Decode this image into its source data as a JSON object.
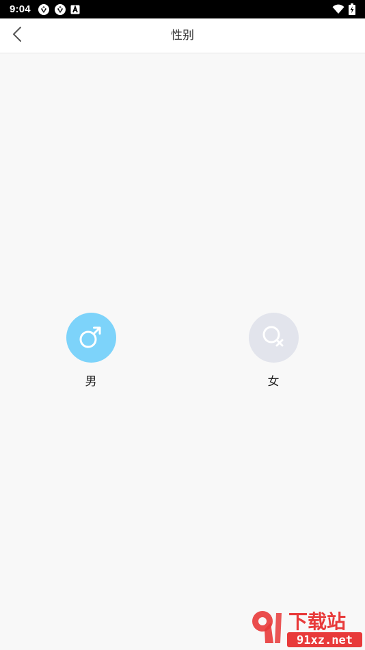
{
  "status_bar": {
    "time": "9:04",
    "icons": [
      "aperture-icon",
      "aperture-icon",
      "font-a-icon",
      "wifi-icon",
      "battery-charging-icon"
    ]
  },
  "header": {
    "title": "性别",
    "back_icon": "chevron-left-icon"
  },
  "options": [
    {
      "label": "男",
      "icon": "male-symbol-icon",
      "color": "#7dd3fa",
      "selected": true
    },
    {
      "label": "女",
      "icon": "female-symbol-icon",
      "color": "#e2e4ec",
      "selected": false
    }
  ],
  "watermark": {
    "brand": "下载站",
    "domain": "91xz.net",
    "color": "#e83a3a"
  }
}
